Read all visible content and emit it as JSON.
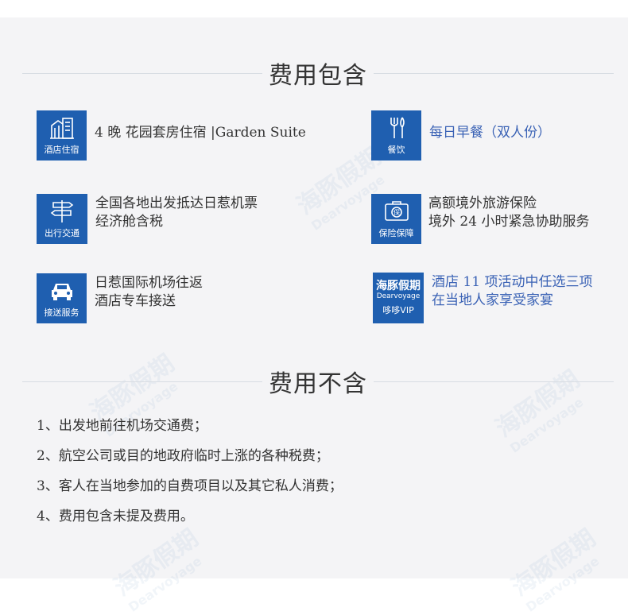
{
  "included": {
    "title": "费用包含",
    "items": [
      {
        "icon": "hotel-icon",
        "label": "酒店住宿",
        "text": [
          "4 晚 花园套房住宿 |Garden Suite"
        ]
      },
      {
        "icon": "dining-icon",
        "label": "餐饮",
        "text": [
          "每日早餐（双人份）"
        ]
      },
      {
        "icon": "signpost-icon",
        "label": "出行交通",
        "text": [
          "全国各地出发抵达日惹机票",
          "经济舱含税"
        ]
      },
      {
        "icon": "insurance-icon",
        "label": "保险保障",
        "text": [
          "高额境外旅游保险",
          "境外 24 小时紧急协助服务"
        ]
      },
      {
        "icon": "car-icon",
        "label": "接送服务",
        "text": [
          "日惹国际机场往返",
          "酒店专车接送"
        ]
      },
      {
        "icon": "dearvoyage-logo",
        "brand": "海豚假期",
        "brand_sub": "Dearvoyage",
        "label": "哆哆VIP",
        "text": [
          "酒店 11 项活动中任选三项",
          "在当地人家享受家宴"
        ]
      }
    ]
  },
  "excluded": {
    "title": "费用不含",
    "items": [
      "1、出发地前往机场交通费；",
      "2、航空公司或目的地政府临时上涨的各种税费；",
      "3、客人在当地参加的自费项目以及其它私人消费；",
      "4、费用包含未提及费用。"
    ]
  },
  "watermark": {
    "brand": "海豚假期",
    "sub": "Dearvoyage"
  },
  "colors": {
    "icon_bg": "#1f5fb0",
    "highlight_text": "#3a62b5",
    "panel_bg": "#f4f4f6"
  }
}
